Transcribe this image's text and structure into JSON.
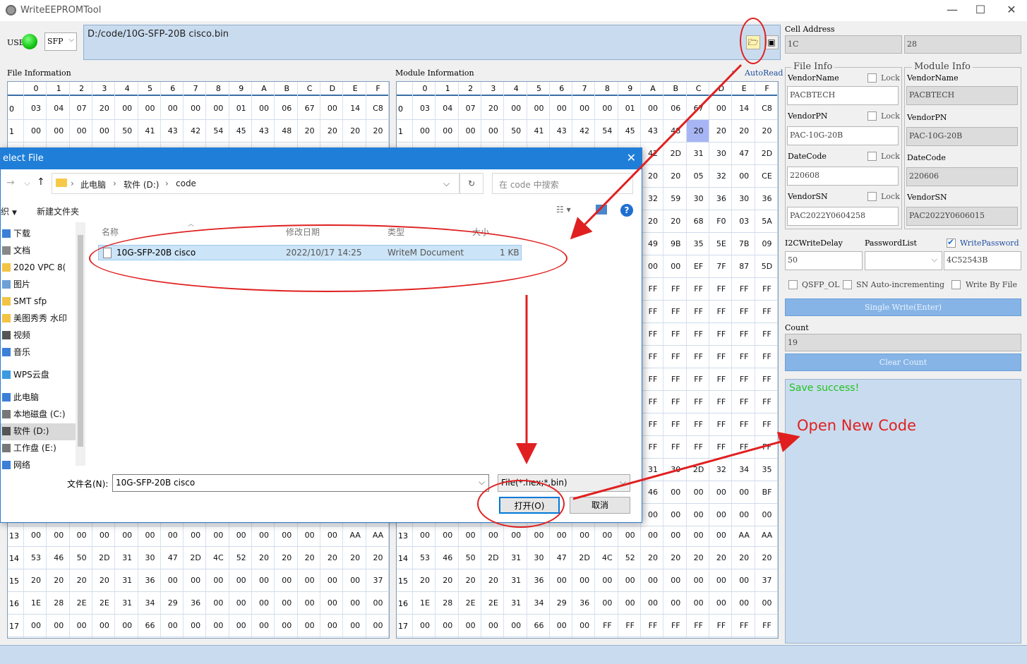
{
  "window": {
    "title": "WriteEEPROMTool"
  },
  "top": {
    "usb_label": "USB",
    "type_select": "SFP",
    "file_path": "D:/code/10G-SFP-20B cisco.bin"
  },
  "cell_address": {
    "label": "Cell Address",
    "left_value": "1C",
    "right_value": "28"
  },
  "file_section": {
    "label": "File Information"
  },
  "module_section": {
    "label": "Module Information",
    "autoread_label": "AutoRead"
  },
  "hex_columns": [
    "0",
    "1",
    "2",
    "3",
    "4",
    "5",
    "6",
    "7",
    "8",
    "9",
    "A",
    "B",
    "C",
    "D",
    "E",
    "F"
  ],
  "file_hex_top": [
    {
      "idx": "0",
      "cells": [
        "03",
        "04",
        "07",
        "20",
        "00",
        "00",
        "00",
        "00",
        "00",
        "01",
        "00",
        "06",
        "67",
        "00",
        "14",
        "C8"
      ]
    },
    {
      "idx": "1",
      "cells": [
        "00",
        "00",
        "00",
        "00",
        "50",
        "41",
        "43",
        "42",
        "54",
        "45",
        "43",
        "48",
        "20",
        "20",
        "20",
        "20"
      ]
    }
  ],
  "module_hex_top": [
    {
      "idx": "0",
      "cells": [
        "03",
        "04",
        "07",
        "20",
        "00",
        "00",
        "00",
        "00",
        "00",
        "01",
        "00",
        "06",
        "67",
        "00",
        "14",
        "C8"
      ]
    },
    {
      "idx": "1",
      "cells": [
        "00",
        "00",
        "00",
        "00",
        "50",
        "41",
        "43",
        "42",
        "54",
        "45",
        "43",
        "48",
        "20",
        "20",
        "20",
        "20"
      ]
    }
  ],
  "module_hex_visible_right": [
    [
      "42",
      "2D",
      "31",
      "30",
      "47",
      "2D"
    ],
    [
      "20",
      "20",
      "05",
      "32",
      "00",
      "CE"
    ],
    [
      "32",
      "59",
      "30",
      "36",
      "30",
      "36"
    ],
    [
      "20",
      "20",
      "68",
      "F0",
      "03",
      "5A"
    ],
    [
      "49",
      "9B",
      "35",
      "5E",
      "7B",
      "09"
    ],
    [
      "00",
      "00",
      "EF",
      "7F",
      "87",
      "5D"
    ],
    [
      "FF",
      "FF",
      "FF",
      "FF",
      "FF",
      "FF"
    ],
    [
      "FF",
      "FF",
      "FF",
      "FF",
      "FF",
      "FF"
    ],
    [
      "FF",
      "FF",
      "FF",
      "FF",
      "FF",
      "FF"
    ],
    [
      "FF",
      "FF",
      "FF",
      "FF",
      "FF",
      "FF"
    ],
    [
      "FF",
      "FF",
      "FF",
      "FF",
      "FF",
      "FF"
    ],
    [
      "FF",
      "FF",
      "FF",
      "FF",
      "FF",
      "FF"
    ],
    [
      "FF",
      "FF",
      "FF",
      "FF",
      "FF",
      "FF"
    ],
    [
      "FF",
      "FF",
      "FF",
      "FF",
      "FF",
      "FF"
    ],
    [
      "31",
      "30",
      "2D",
      "32",
      "34",
      "35"
    ],
    [
      "46",
      "00",
      "00",
      "00",
      "00",
      "BF"
    ],
    [
      "00",
      "00",
      "00",
      "00",
      "00",
      "00"
    ]
  ],
  "file_hex_bottom": [
    {
      "idx": "13",
      "cells": [
        "00",
        "00",
        "00",
        "00",
        "00",
        "00",
        "00",
        "00",
        "00",
        "00",
        "00",
        "00",
        "00",
        "00",
        "AA",
        "AA"
      ]
    },
    {
      "idx": "14",
      "cells": [
        "53",
        "46",
        "50",
        "2D",
        "31",
        "30",
        "47",
        "2D",
        "4C",
        "52",
        "20",
        "20",
        "20",
        "20",
        "20",
        "20"
      ]
    },
    {
      "idx": "15",
      "cells": [
        "20",
        "20",
        "20",
        "20",
        "31",
        "36",
        "00",
        "00",
        "00",
        "00",
        "00",
        "00",
        "00",
        "00",
        "00",
        "37"
      ]
    },
    {
      "idx": "16",
      "cells": [
        "1E",
        "28",
        "2E",
        "2E",
        "31",
        "34",
        "29",
        "36",
        "00",
        "00",
        "00",
        "00",
        "00",
        "00",
        "00",
        "00"
      ]
    },
    {
      "idx": "17",
      "cells": [
        "00",
        "00",
        "00",
        "00",
        "00",
        "66",
        "00",
        "00",
        "00",
        "00",
        "00",
        "00",
        "00",
        "00",
        "00",
        "00"
      ]
    }
  ],
  "module_hex_bottom": [
    {
      "idx": "13",
      "cells": [
        "00",
        "00",
        "00",
        "00",
        "00",
        "00",
        "00",
        "00",
        "00",
        "00",
        "00",
        "00",
        "00",
        "00",
        "AA",
        "AA"
      ]
    },
    {
      "idx": "14",
      "cells": [
        "53",
        "46",
        "50",
        "2D",
        "31",
        "30",
        "47",
        "2D",
        "4C",
        "52",
        "20",
        "20",
        "20",
        "20",
        "20",
        "20"
      ]
    },
    {
      "idx": "15",
      "cells": [
        "20",
        "20",
        "20",
        "20",
        "31",
        "36",
        "00",
        "00",
        "00",
        "00",
        "00",
        "00",
        "00",
        "00",
        "00",
        "37"
      ]
    },
    {
      "idx": "16",
      "cells": [
        "1E",
        "28",
        "2E",
        "2E",
        "31",
        "34",
        "29",
        "36",
        "00",
        "00",
        "00",
        "00",
        "00",
        "00",
        "00",
        "00"
      ]
    },
    {
      "idx": "17",
      "cells": [
        "00",
        "00",
        "00",
        "00",
        "00",
        "66",
        "00",
        "00",
        "FF",
        "FF",
        "FF",
        "FF",
        "FF",
        "FF",
        "FF",
        "FF"
      ]
    }
  ],
  "file_info": {
    "title": "File Info",
    "lock": "Lock",
    "vendor_name_label": "VendorName",
    "vendor_name": "PACBTECH",
    "vendor_pn_label": "VendorPN",
    "vendor_pn": "PAC-10G-20B",
    "date_code_label": "DateCode",
    "date_code": "220608",
    "vendor_sn_label": "VendorSN",
    "vendor_sn": "PAC2022Y0604258"
  },
  "module_info": {
    "title": "Module Info",
    "vendor_name_label": "VendorName",
    "vendor_name": "PACBTECH",
    "vendor_pn_label": "VendorPN",
    "vendor_pn": "PAC-10G-20B",
    "date_code_label": "DateCode",
    "date_code": "220606",
    "vendor_sn_label": "VendorSN",
    "vendor_sn": "PAC2022Y0606015"
  },
  "settings": {
    "i2c_label": "I2CWriteDelay",
    "i2c_value": "50",
    "password_list_label": "PasswordList",
    "write_password_label": "WritePassword",
    "password_value": "4C52543B",
    "qsfp_ol": "QSFP_OL",
    "sn_auto": "SN Auto-incrementing",
    "write_by_file": "Write By File",
    "single_write": "Single Write(Enter)",
    "count_label": "Count",
    "count_value": "19",
    "clear_count": "Clear Count"
  },
  "log": {
    "message": "Save success!",
    "annotation": "Open New Code"
  },
  "dialog": {
    "title": "elect File",
    "breadcrumb": [
      "此电脑",
      "软件 (D:)",
      "code"
    ],
    "search_placeholder": "在 code 中搜索",
    "toolbar_left": "织",
    "new_folder": "新建文件夹",
    "nav_items": [
      "下载",
      "文档",
      "2020 VPC 8(",
      "图片",
      "SMT sfp",
      "美图秀秀 水印",
      "视频",
      "音乐",
      "WPS云盘",
      "此电脑",
      "本地磁盘 (C:)",
      "软件 (D:)",
      "工作盘  (E:)",
      "网络"
    ],
    "columns": {
      "name": "名称",
      "date": "修改日期",
      "type": "类型",
      "size": "大小"
    },
    "files": [
      {
        "name": "10G-SFP-20B cisco",
        "date": "2022/10/17 14:25",
        "type": "WriteM Document",
        "size": "1 KB"
      }
    ],
    "filename_label": "文件名(N):",
    "filename_value": "10G-SFP-20B cisco",
    "filter": "File(*.hex;*.bin)",
    "open": "打开(O)",
    "cancel": "取消"
  },
  "colors": {
    "accent": "#1f7fd8",
    "annotation": "#e02020",
    "panel_blue": "#c9dcef",
    "button_blue": "#86b4e6",
    "led_green": "#12c412",
    "highlight_cell": "#8b9cf0"
  }
}
